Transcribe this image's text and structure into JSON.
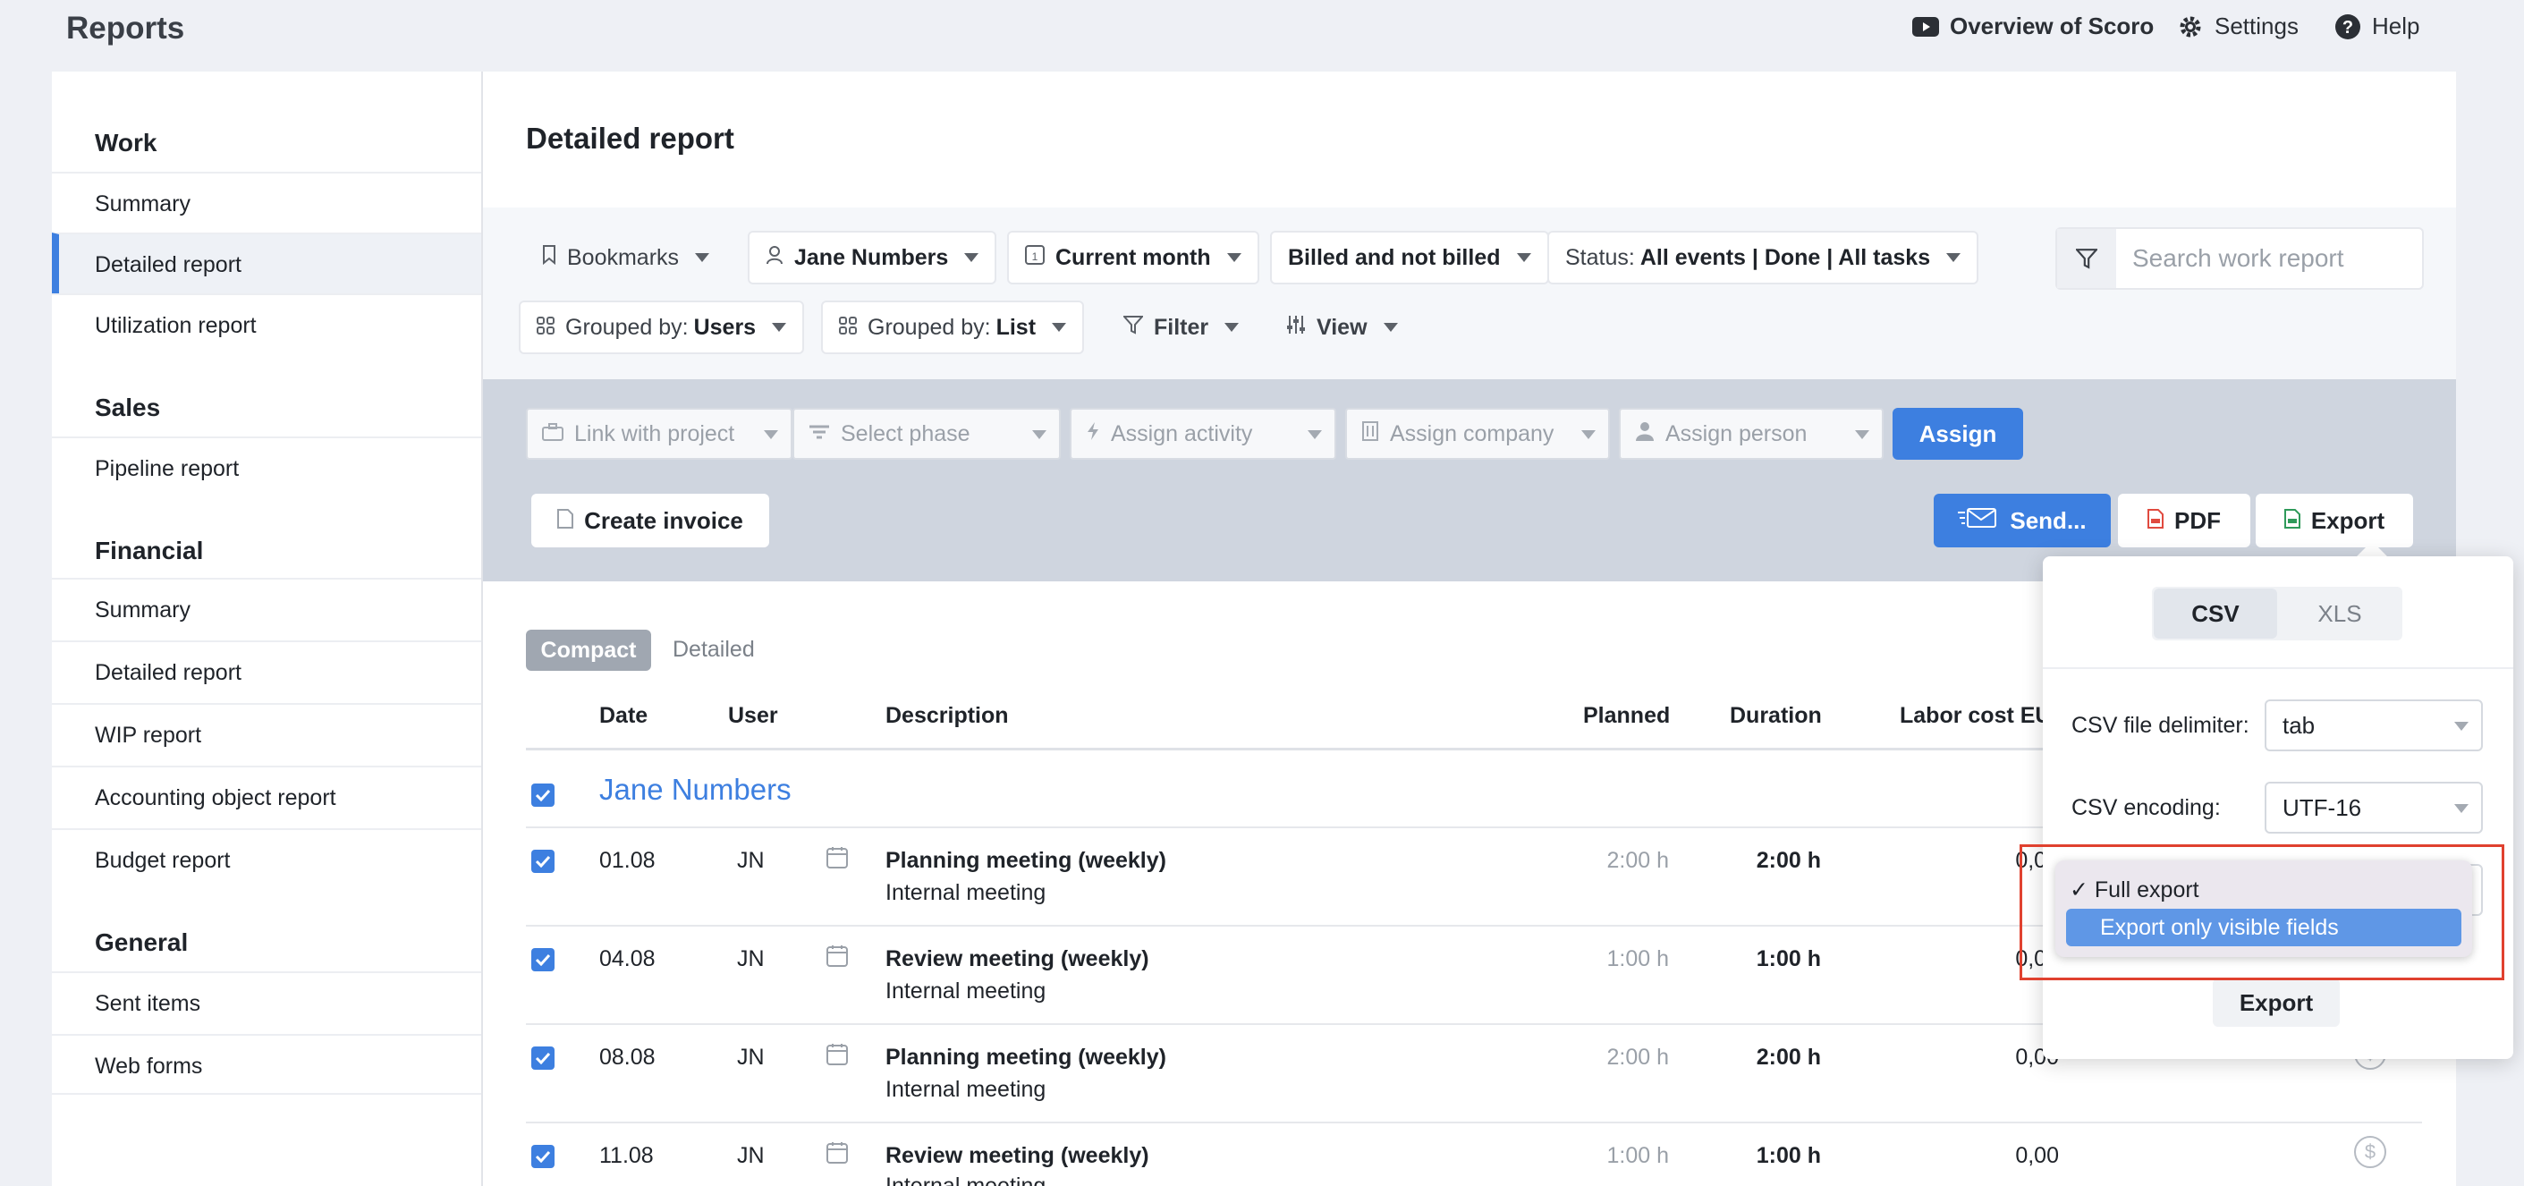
{
  "app": {
    "title": "Reports"
  },
  "topbar": {
    "overview": "Overview of Scoro",
    "settings": "Settings",
    "help": "Help"
  },
  "sidebar": {
    "work": {
      "heading": "Work",
      "items": [
        "Summary",
        "Detailed report",
        "Utilization report"
      ]
    },
    "sales": {
      "heading": "Sales",
      "items": [
        "Pipeline report"
      ]
    },
    "financial": {
      "heading": "Financial",
      "items": [
        "Summary",
        "Detailed report",
        "WIP report",
        "Accounting object report",
        "Budget report"
      ]
    },
    "general": {
      "heading": "General",
      "items": [
        "Sent items",
        "Web forms"
      ]
    },
    "active": "Detailed report"
  },
  "page": {
    "title": "Detailed report"
  },
  "filters": {
    "bookmarks": "Bookmarks",
    "user": "Jane Numbers",
    "period": "Current month",
    "billing": "Billed and not billed",
    "status_label": "Status:",
    "status_value": "All events | Done | All tasks",
    "group1_label": "Grouped by:",
    "group1_value": "Users",
    "group2_label": "Grouped by:",
    "group2_value": "List",
    "filter": "Filter",
    "view": "View",
    "search_placeholder": "Search work report"
  },
  "actions": {
    "link_project": "Link with project",
    "select_phase": "Select phase",
    "assign_activity": "Assign activity",
    "assign_company": "Assign company",
    "assign_person": "Assign person",
    "assign": "Assign",
    "create_invoice": "Create invoice",
    "send": "Send...",
    "pdf": "PDF",
    "export": "Export"
  },
  "table": {
    "view_compact": "Compact",
    "view_detailed": "Detailed",
    "columns": {
      "date": "Date",
      "user": "User",
      "description": "Description",
      "planned": "Planned",
      "duration": "Duration",
      "labor_cost": "Labor cost EU"
    },
    "group": "Jane Numbers",
    "rows": [
      {
        "date": "01.08",
        "user": "JN",
        "title": "Planning meeting (weekly)",
        "subtitle": "Internal meeting",
        "planned": "2:00 h",
        "duration": "2:00 h",
        "cost": "0,00"
      },
      {
        "date": "04.08",
        "user": "JN",
        "title": "Review meeting (weekly)",
        "subtitle": "Internal meeting",
        "planned": "1:00 h",
        "duration": "1:00 h",
        "cost": "0,00"
      },
      {
        "date": "08.08",
        "user": "JN",
        "title": "Planning meeting (weekly)",
        "subtitle": "Internal meeting",
        "planned": "2:00 h",
        "duration": "2:00 h",
        "cost": "0,00"
      },
      {
        "date": "11.08",
        "user": "JN",
        "title": "Review meeting (weekly)",
        "subtitle": "Internal meeting",
        "planned": "1:00 h",
        "duration": "1:00 h",
        "cost": "0,00"
      }
    ]
  },
  "export_popover": {
    "tab_csv": "CSV",
    "tab_xls": "XLS",
    "active_tab": "CSV",
    "delimiter_label": "CSV file delimiter:",
    "delimiter_value": "tab",
    "encoding_label": "CSV encoding:",
    "encoding_value": "UTF-16",
    "submit": "Export",
    "menu": {
      "options": [
        "Full export",
        "Export only visible fields"
      ],
      "selected": "Full export",
      "highlighted": "Export only visible fields",
      "check_glyph": "✓"
    }
  },
  "colors": {
    "accent": "#3d7fe0",
    "highlight_border": "#e0412f",
    "menu_highlight": "#5f97e6"
  }
}
